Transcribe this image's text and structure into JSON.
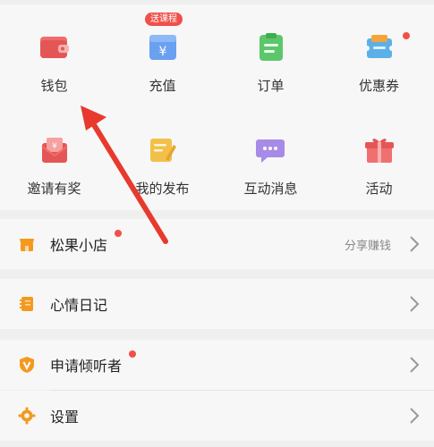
{
  "grid": {
    "items": [
      {
        "label": "钱包",
        "icon": "wallet-icon"
      },
      {
        "label": "充值",
        "icon": "recharge-icon"
      },
      {
        "label": "订单",
        "icon": "order-icon"
      },
      {
        "label": "优惠券",
        "icon": "coupon-icon"
      },
      {
        "label": "邀请有奖",
        "icon": "invite-reward-icon"
      },
      {
        "label": "我的发布",
        "icon": "my-posts-icon"
      },
      {
        "label": "互动消息",
        "icon": "message-icon"
      },
      {
        "label": "活动",
        "icon": "gift-icon"
      }
    ],
    "promo_badge": "送课程"
  },
  "list": [
    {
      "title": "松果小店",
      "right_text": "分享赚钱",
      "icon": "shop-icon"
    },
    {
      "title": "心情日记",
      "right_text": "",
      "icon": "diary-icon"
    },
    {
      "title": "申请倾听者",
      "right_text": "",
      "icon": "listener-badge-icon"
    },
    {
      "title": "设置",
      "right_text": "",
      "icon": "settings-gear-icon"
    }
  ],
  "colors": {
    "accent_red": "#f0504a",
    "orange": "#f39a1e",
    "arrow": "#e8392e"
  }
}
